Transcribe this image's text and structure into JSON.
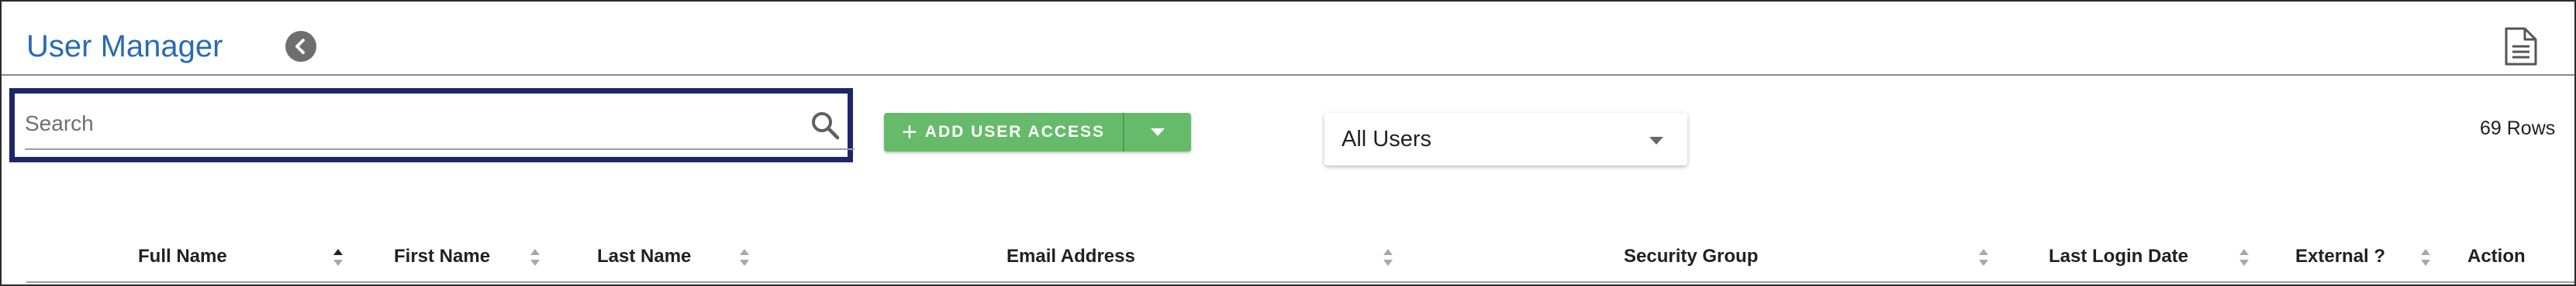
{
  "header": {
    "title": "User Manager",
    "back_icon": "back-arrow-icon",
    "doc_icon": "document-icon"
  },
  "search": {
    "placeholder": "Search",
    "value": ""
  },
  "toolbar": {
    "add_label": "ADD USER ACCESS",
    "add_color": "#66bb6a",
    "filter_value": "All Users",
    "row_count": "69 Rows"
  },
  "table": {
    "columns": [
      {
        "label": "Full Name",
        "sort": "ascending"
      },
      {
        "label": "First Name",
        "sort": "none"
      },
      {
        "label": "Last Name",
        "sort": "none"
      },
      {
        "label": "Email Address",
        "sort": "none"
      },
      {
        "label": "Security Group",
        "sort": "none"
      },
      {
        "label": "Last Login Date",
        "sort": "none"
      },
      {
        "label": "External ?",
        "sort": "none"
      },
      {
        "label": "Action",
        "sort": "none"
      }
    ]
  },
  "colors": {
    "title": "#2a6ab3",
    "highlight_border": "#1f2668"
  }
}
